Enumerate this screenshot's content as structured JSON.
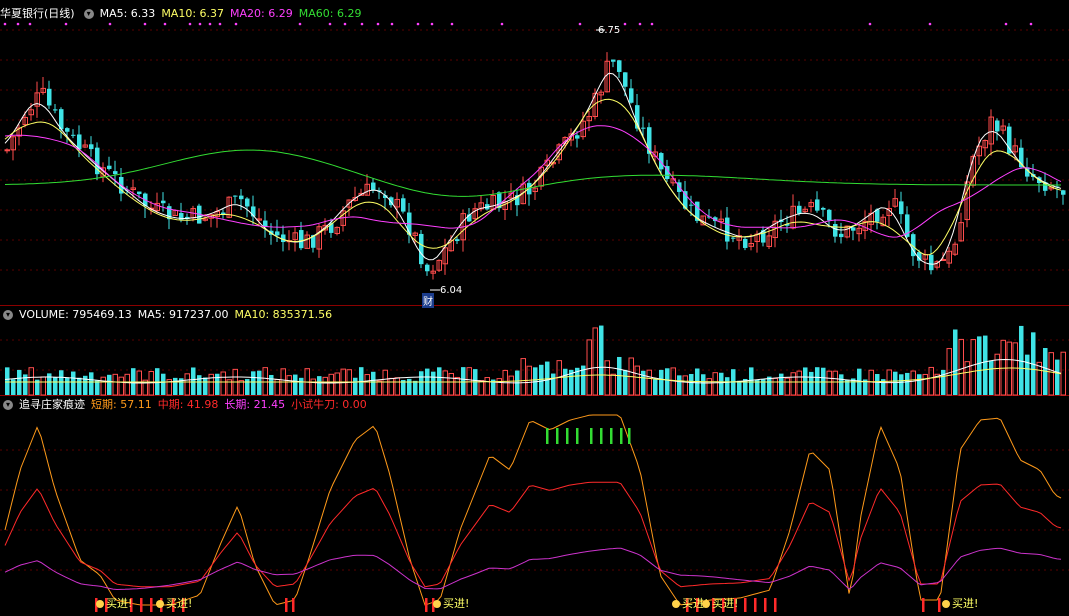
{
  "colors": {
    "up": "#ff4d4d",
    "down": "#3fe3e6",
    "ma5": "#ffffff",
    "ma10": "#ffff66",
    "ma20": "#ff40ff",
    "ma60": "#33dd33",
    "short": "#ff9a1a",
    "mid": "#ff2a2a",
    "long": "#cc33cc",
    "label": "#ffffff"
  },
  "price_panel": {
    "title": "华夏银行(日线)",
    "ma5_label": "MA5: 6.33",
    "ma10_label": "MA10: 6.37",
    "ma20_label": "MA20: 6.29",
    "ma60_label": "MA60: 6.29",
    "high_marker": "6.75",
    "low_marker": "6.04",
    "event_tag": "财"
  },
  "volume_panel": {
    "volume_label": "VOLUME: 795469.13",
    "ma5_label": "MA5: 917237.00",
    "ma10_label": "MA10: 835371.56"
  },
  "indicator_panel": {
    "title": "追寻庄家痕迹",
    "short_label": "短期: 57.11",
    "mid_label": "中期: 41.98",
    "long_label": "长期: 21.45",
    "trial_label": "小试牛刀: 0.00",
    "buy_signal_text": "买进!"
  },
  "chart_data": {
    "type": "candlestick",
    "series": [
      {
        "name": "MA5",
        "last": 6.33
      },
      {
        "name": "MA10",
        "last": 6.37
      },
      {
        "name": "MA20",
        "last": 6.29
      },
      {
        "name": "MA60",
        "last": 6.29
      },
      {
        "name": "VOLUME",
        "last": 795469.13
      },
      {
        "name": "短期",
        "last": 57.11
      },
      {
        "name": "中期",
        "last": 41.98
      },
      {
        "name": "长期",
        "last": 21.45
      },
      {
        "name": "小试牛刀",
        "last": 0.0
      }
    ],
    "annotations": [
      "6.75",
      "6.04",
      "财"
    ],
    "price_range": [
      6.04,
      6.75
    ]
  }
}
